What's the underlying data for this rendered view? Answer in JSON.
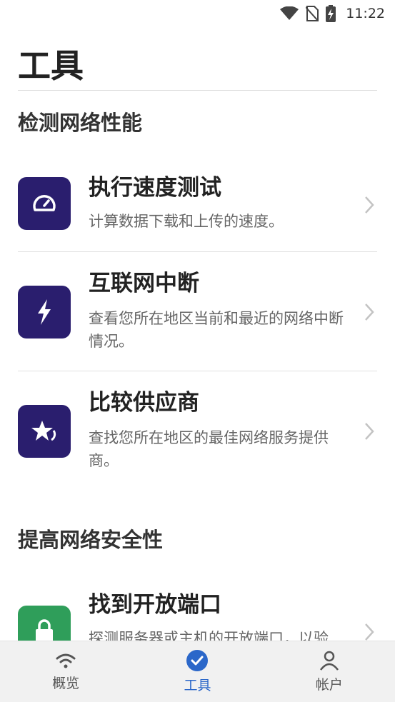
{
  "status": {
    "time": "11:22"
  },
  "page": {
    "title": "工具"
  },
  "sections": [
    {
      "title": "检测网络性能",
      "items": [
        {
          "title": "执行速度测试",
          "desc": "计算数据下载和上传的速度。",
          "icon": "speedometer-icon"
        },
        {
          "title": "互联网中断",
          "desc": "查看您所在地区当前和最近的网络中断情况。",
          "icon": "lightning-icon"
        },
        {
          "title": "比较供应商",
          "desc": "查找您所在地区的最佳网络服务提供商。",
          "icon": "star-icon"
        }
      ]
    },
    {
      "title": "提高网络安全性",
      "items": [
        {
          "title": "找到开放端口",
          "desc": "探测服务器或主机的开放端口，以验",
          "icon": "lock-icon"
        }
      ]
    }
  ],
  "nav": [
    {
      "label": "概览",
      "icon": "wifi-icon",
      "active": false
    },
    {
      "label": "工具",
      "icon": "check-circle-icon",
      "active": true
    },
    {
      "label": "帐户",
      "icon": "person-icon",
      "active": false
    }
  ],
  "colors": {
    "icon_bg": "#2a1e6e",
    "icon_bg_green": "#2f9e5a",
    "active_nav": "#2b67c9"
  }
}
